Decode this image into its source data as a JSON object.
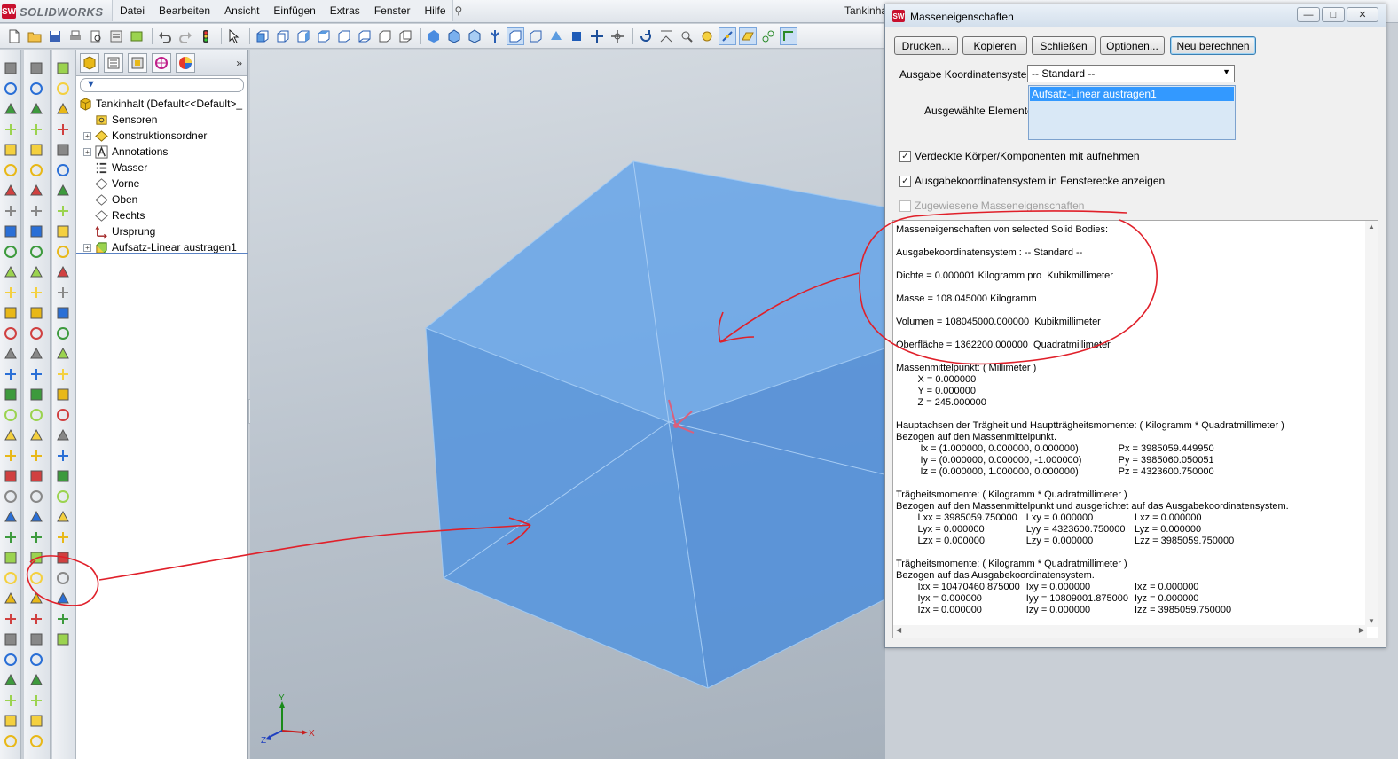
{
  "app": {
    "logo_text": "SOLIDWORKS",
    "window_title": "Tankinhalt",
    "menu": [
      "Datei",
      "Bearbeiten",
      "Ansicht",
      "Einfügen",
      "Extras",
      "Fenster",
      "Hilfe"
    ]
  },
  "feature_tree": {
    "root": "Tankinhalt  (Default<<Default>_",
    "items": [
      {
        "label": "Sensoren",
        "icon": "sensor-icon",
        "expandable": false
      },
      {
        "label": "Konstruktionsordner",
        "icon": "design-folder-icon",
        "expandable": true
      },
      {
        "label": "Annotations",
        "icon": "annotations-icon",
        "expandable": true
      },
      {
        "label": "Wasser",
        "icon": "material-icon",
        "expandable": false
      },
      {
        "label": "Vorne",
        "icon": "plane-icon",
        "expandable": false
      },
      {
        "label": "Oben",
        "icon": "plane-icon",
        "expandable": false
      },
      {
        "label": "Rechts",
        "icon": "plane-icon",
        "expandable": false
      },
      {
        "label": "Ursprung",
        "icon": "origin-icon",
        "expandable": false
      },
      {
        "label": "Aufsatz-Linear austragen1",
        "icon": "extrude-icon",
        "expandable": true
      }
    ]
  },
  "viewport": {
    "triad_labels": {
      "x": "X",
      "y": "Y",
      "z": "Z"
    },
    "body_color": "#5b9be0"
  },
  "dialog": {
    "title": "Masseneigenschaften",
    "buttons": {
      "print": "Drucken...",
      "copy": "Kopieren",
      "close": "Schließen",
      "options": "Optionen...",
      "recalc": "Neu berechnen"
    },
    "coord_label": "Ausgabe Koordinatensystem:",
    "coord_value": "-- Standard --",
    "selected_label": "Ausgewählte Elemente:",
    "selected_item": "Aufsatz-Linear austragen1",
    "check1": "Verdeckte Körper/Komponenten mit aufnehmen",
    "check2": "Ausgabekoordinatensystem in Fensterecke anzeigen",
    "check3": "Zugewiesene Masseneigenschaften",
    "check1_checked": true,
    "check2_checked": true,
    "check3_checked": false,
    "results": "Masseneigenschaften von selected Solid Bodies:\n\nAusgabekoordinatensystem : -- Standard --\n\nDichte = 0.000001 Kilogramm pro  Kubikmillimeter\n\nMasse = 108.045000 Kilogramm\n\nVolumen = 108045000.000000  Kubikmillimeter\n\nOberfläche = 1362200.000000  Quadratmillimeter\n\nMassenmittelpunkt: ( Millimeter )\n\tX = 0.000000\n\tY = 0.000000\n\tZ = 245.000000\n\nHauptachsen der Trägheit und Hauptträgheitsmomente: ( Kilogramm * Quadratmillimeter )\nBezogen auf den Massenmittelpunkt.\n\t Ix = (1.000000, 0.000000, 0.000000)   \t\t  Px = 3985059.449950\n\t Iy = (0.000000, 0.000000, -1.000000)  \t\t  Py = 3985060.050051\n\t Iz = (0.000000, 1.000000, 0.000000)   \t\t  Pz = 4323600.750000\n\nTrägheitsmomente: ( Kilogramm * Quadratmillimeter )\nBezogen auf den Massenmittelpunkt und ausgerichtet auf das Ausgabekoordinatensystem.\n\tLxx = 3985059.750000\tLxy = 0.000000\t\tLxz = 0.000000\n\tLyx = 0.000000\t\tLyy = 4323600.750000\tLyz = 0.000000\n\tLzx = 0.000000\t\tLzy = 0.000000\t\tLzz = 3985059.750000\n\nTrägheitsmomente: ( Kilogramm * Quadratmillimeter )\nBezogen auf das Ausgabekoordinatensystem.\n\tIxx = 10470460.875000\tIxy = 0.000000\t\tIxz = 0.000000\n\tIyx = 0.000000\t\tIyy = 10809001.875000\tIyz = 0.000000\n\tIzx = 0.000000\t\tIzy = 0.000000\t\tIzz = 3985059.750000"
  },
  "colors": {
    "annotation_red": "#e0202a",
    "selection_blue": "#3399ff",
    "accent": "#c8102e"
  }
}
